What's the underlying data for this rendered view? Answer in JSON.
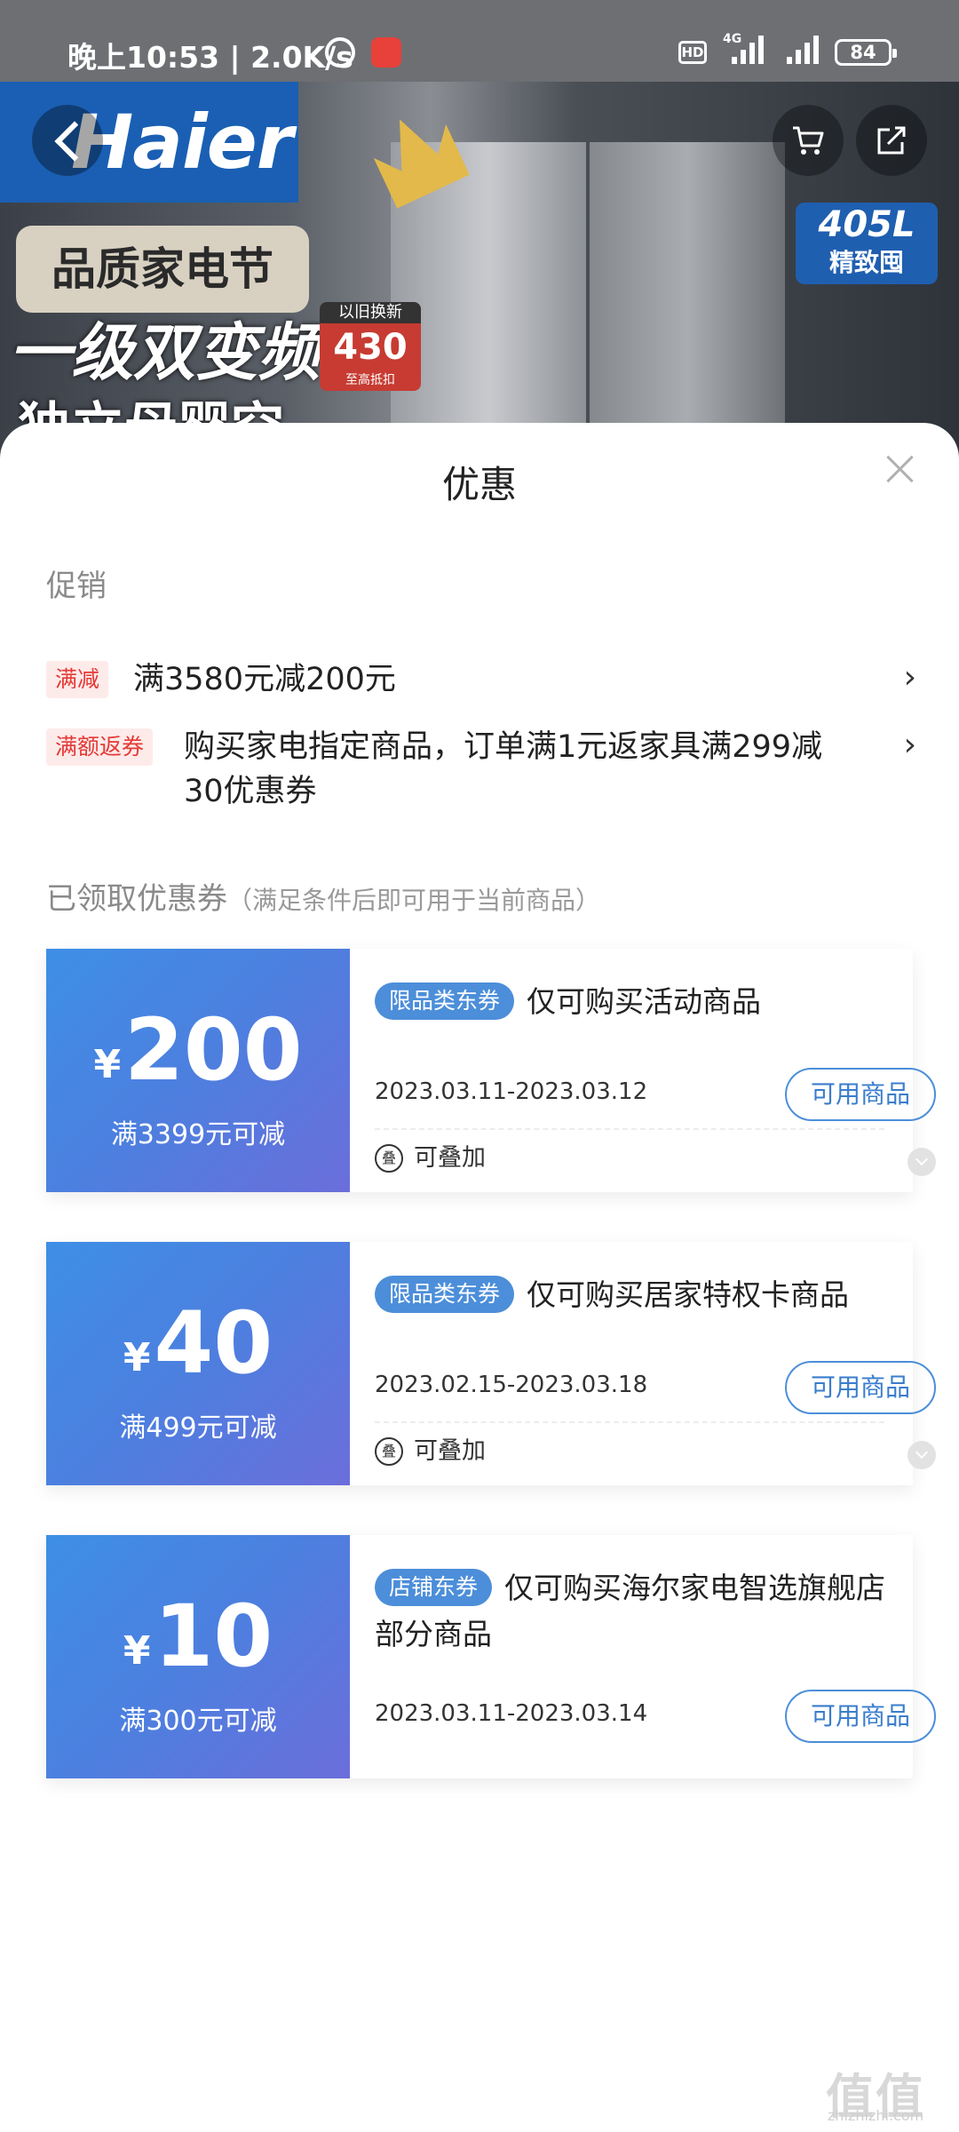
{
  "status_bar": {
    "time": "晚上10:53 | 2.0K/s",
    "hd": "HD",
    "network": "4G",
    "battery": "84"
  },
  "banner": {
    "brand": "Haier",
    "tag_main": "405L",
    "tag_sub": "精致囤",
    "festival": "品质家电节",
    "headline": "一级双变频",
    "headline2": "独立母婴空间",
    "trade_in_top": "以旧换新",
    "trade_in_value": "430",
    "trade_in_bottom": "至高抵扣"
  },
  "sheet": {
    "title": "优惠",
    "promo_section": "促销",
    "promos": [
      {
        "tag": "满减",
        "text": "满3580元减200元"
      },
      {
        "tag": "满额返券",
        "text": "购买家电指定商品，订单满1元返家具满299减30优惠券"
      }
    ],
    "coupon_section": "已领取优惠券",
    "coupon_section_sub": "（满足条件后即可用于当前商品）",
    "coupons": [
      {
        "currency": "¥",
        "amount": "200",
        "condition": "满3399元可减",
        "tag": "限品类东券",
        "desc": "仅可购买活动商品",
        "date": "2023.03.11-2023.03.12",
        "button": "可用商品",
        "stack_icon": "叠",
        "stack": "可叠加"
      },
      {
        "currency": "¥",
        "amount": "40",
        "condition": "满499元可减",
        "tag": "限品类东券",
        "desc": "仅可购买居家特权卡商品",
        "date": "2023.02.15-2023.03.18",
        "button": "可用商品",
        "stack_icon": "叠",
        "stack": "可叠加"
      },
      {
        "currency": "¥",
        "amount": "10",
        "condition": "满300元可减",
        "tag": "店铺东券",
        "desc": "仅可购买海尔家电智选旗舰店部分商品",
        "date": "2023.03.11-2023.03.14",
        "button": "可用商品"
      }
    ]
  },
  "watermark": {
    "main": "值值值",
    "sub": "zhizhizhi.com"
  },
  "colors": {
    "accent": "#4c8ed9",
    "promo_tag_bg": "#fdebea",
    "promo_tag_text": "#e53935",
    "coupon_gradient_start": "#3e8fe6",
    "coupon_gradient_end": "#6b6edb"
  },
  "icons": [
    "alarm-icon",
    "app-icon",
    "signal-icon",
    "battery-icon",
    "back-icon",
    "cart-icon",
    "share-icon",
    "close-icon",
    "chevron-right-icon",
    "stack-icon",
    "expand-icon"
  ]
}
